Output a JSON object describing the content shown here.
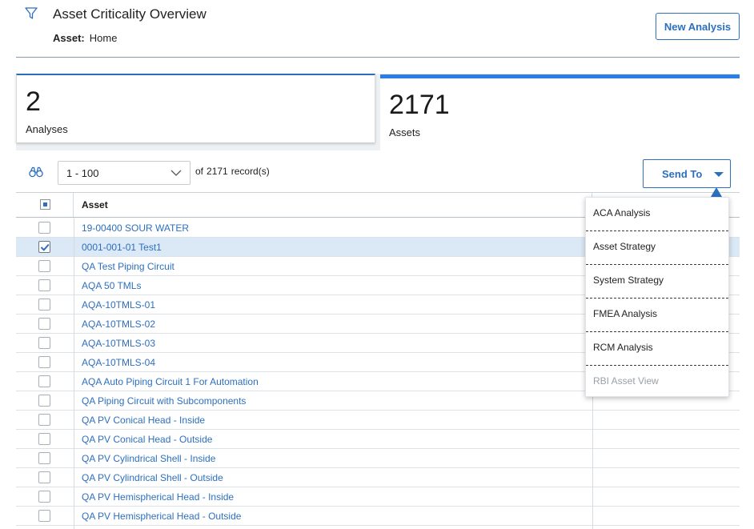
{
  "header": {
    "title": "Asset Criticality Overview",
    "asset_label": "Asset:",
    "asset_value": "Home",
    "new_analysis_label": "New Analysis"
  },
  "cards": {
    "analyses": {
      "count": "2",
      "label": "Analyses"
    },
    "assets": {
      "count": "2171",
      "label": "Assets"
    }
  },
  "toolbar": {
    "range": "1 - 100",
    "of_label": "of",
    "total": "2171",
    "records_label": "record(s)",
    "send_to_label": "Send To"
  },
  "grid": {
    "columns": [
      "Asset"
    ],
    "rows": [
      {
        "asset": "19-00400 SOUR WATER",
        "checked": false
      },
      {
        "asset": "0001-001-01 Test1",
        "checked": true
      },
      {
        "asset": "QA Test Piping Circuit",
        "checked": false
      },
      {
        "asset": "AQA 50 TMLs",
        "checked": false
      },
      {
        "asset": "AQA-10TMLS-01",
        "checked": false
      },
      {
        "asset": "AQA-10TMLS-02",
        "checked": false
      },
      {
        "asset": "AQA-10TMLS-03",
        "checked": false
      },
      {
        "asset": "AQA-10TMLS-04",
        "checked": false
      },
      {
        "asset": "AQA Auto Piping Circuit 1 For Automation",
        "checked": false
      },
      {
        "asset": "QA Piping Circuit with Subcomponents",
        "checked": false
      },
      {
        "asset": "QA PV Conical Head - Inside",
        "checked": false
      },
      {
        "asset": "QA PV Conical Head - Outside",
        "checked": false
      },
      {
        "asset": "QA PV Cylindrical Shell - Inside",
        "checked": false
      },
      {
        "asset": "QA PV Cylindrical Shell - Outside",
        "checked": false
      },
      {
        "asset": "QA PV Hemispherical Head - Inside",
        "checked": false
      },
      {
        "asset": "QA PV Hemispherical Head - Outside",
        "checked": false
      },
      {
        "asset": "",
        "checked": false
      }
    ]
  },
  "send_to_menu": {
    "items": [
      {
        "label": "ACA Analysis",
        "disabled": false
      },
      {
        "label": "Asset Strategy",
        "disabled": false
      },
      {
        "label": "System Strategy",
        "disabled": false
      },
      {
        "label": "FMEA Analysis",
        "disabled": false
      },
      {
        "label": "RCM Analysis",
        "disabled": false
      },
      {
        "label": "RBI Asset View",
        "disabled": true
      }
    ]
  },
  "colors": {
    "accent": "#2c6fbf",
    "link": "#2d6fbf",
    "selected_row": "#dbe8f5",
    "active_tab_bar": "#2b7de9"
  },
  "icons": {
    "filter": "filter-icon",
    "search": "binoculars-icon",
    "dropdown": "chevron-down-icon",
    "send_to_caret": "caret-down-icon",
    "check": "checkmark-icon"
  }
}
